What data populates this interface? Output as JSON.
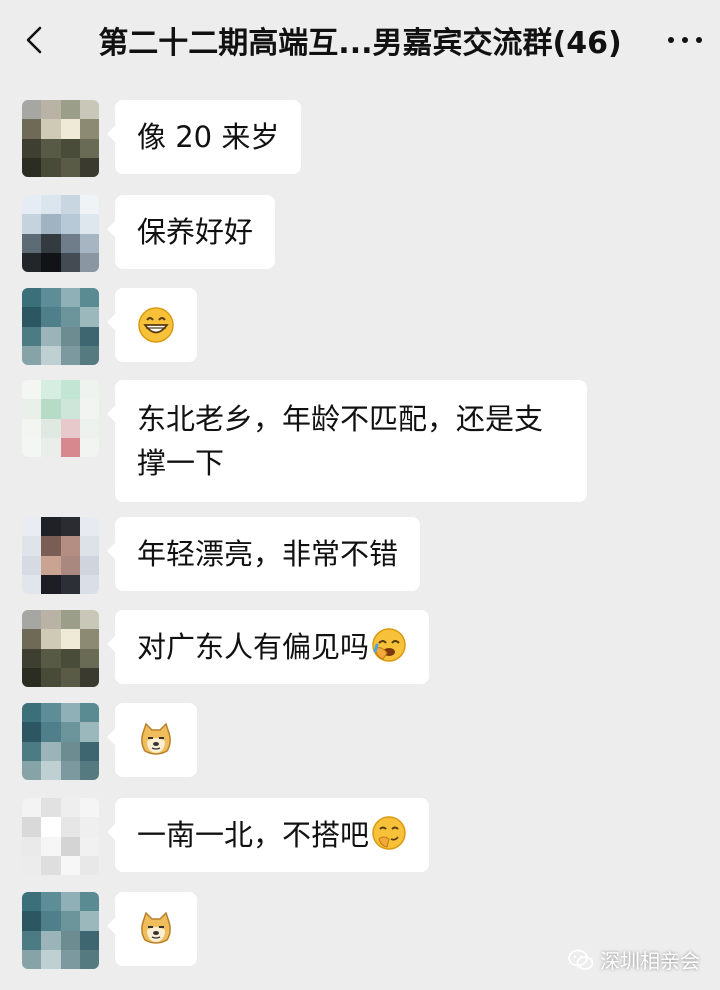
{
  "header": {
    "title": "第二十二期高端互...男嘉宾交流群(46)",
    "back_icon": "chevron-left-icon",
    "more_icon": "more-dots-icon"
  },
  "messages": [
    {
      "text": "像 20 来岁",
      "emoji": null,
      "avatar_colors": [
        "#a6a7a3",
        "#b8b3a5",
        "#9b9f8a",
        "#c9c7b8",
        "#6f6a55",
        "#cfcab5",
        "#efe9d8",
        "#8c8a72",
        "#3e3f30",
        "#575a45",
        "#4a4c3a",
        "#6a6b54",
        "#2b2c22",
        "#494b39",
        "#5a5b46",
        "#3a3b2e"
      ]
    },
    {
      "text": "保养好好",
      "emoji": null,
      "avatar_colors": [
        "#e5ecf3",
        "#dbe5ee",
        "#c8d6e2",
        "#f0f3f6",
        "#c5d3df",
        "#9fb3c3",
        "#b7c8d6",
        "#dfe7ee",
        "#5d6b75",
        "#333a40",
        "#6e7d89",
        "#a6b5c1",
        "#222628",
        "#111316",
        "#444b52",
        "#8a97a2"
      ]
    },
    {
      "text": "",
      "emoji": "grin-emoji",
      "avatar_colors": [
        "#3b6f7a",
        "#5d8e98",
        "#8fb0b6",
        "#5a8a92",
        "#2c5661",
        "#4f7f88",
        "#6c949b",
        "#9bb8bd",
        "#4d7b84",
        "#9bb4b9",
        "#6c8c92",
        "#3e6670",
        "#86a3a8",
        "#bfd0d3",
        "#7b999e",
        "#557a80"
      ]
    },
    {
      "text": "东北老乡，年龄不匹配，还是支撑一下",
      "emoji": null,
      "avatar_colors": [
        "#f3f6f3",
        "#d6ede1",
        "#c3e6d4",
        "#eef3ef",
        "#e9f0ea",
        "#b6dcc8",
        "#cde6d9",
        "#f1f4f1",
        "#f3f5f3",
        "#dfe9e2",
        "#e7c9cb",
        "#eef2ee",
        "#f4f6f4",
        "#eaeeea",
        "#d7888f",
        "#f2f4f2"
      ]
    },
    {
      "text": "年轻漂亮，非常不错",
      "emoji": null,
      "avatar_colors": [
        "#e9ecf2",
        "#1f2127",
        "#2a2c31",
        "#e7eaf0",
        "#dfe3ea",
        "#7a5e55",
        "#b48e82",
        "#dde1e8",
        "#d5dae3",
        "#caa393",
        "#a9897f",
        "#cfd4dd",
        "#e1e5ec",
        "#1c1e24",
        "#2c2f36",
        "#dadee6"
      ]
    },
    {
      "text": "对广东人有偏见吗",
      "emoji": "facepalm-emoji",
      "avatar_colors": [
        "#a6a7a3",
        "#b8b3a5",
        "#9b9f8a",
        "#c9c7b8",
        "#6f6a55",
        "#cfcab5",
        "#efe9d8",
        "#8c8a72",
        "#3e3f30",
        "#575a45",
        "#4a4c3a",
        "#6a6b54",
        "#2b2c22",
        "#494b39",
        "#5a5b46",
        "#3a3b2e"
      ]
    },
    {
      "text": "",
      "emoji": "doge-emoji",
      "avatar_colors": [
        "#3b6f7a",
        "#5d8e98",
        "#8fb0b6",
        "#5a8a92",
        "#2c5661",
        "#4f7f88",
        "#6c949b",
        "#9bb8bd",
        "#4d7b84",
        "#9bb4b9",
        "#6c8c92",
        "#3e6670",
        "#86a3a8",
        "#bfd0d3",
        "#7b999e",
        "#557a80"
      ]
    },
    {
      "text": "一南一北，不搭吧",
      "emoji": "hehe-emoji",
      "avatar_colors": [
        "#f3f3f3",
        "#e1e1e1",
        "#eeeeee",
        "#f5f5f5",
        "#d9d9d9",
        "#ffffff",
        "#e6e6e6",
        "#efefef",
        "#eaeaea",
        "#f6f6f6",
        "#d4d4d4",
        "#f1f1f1",
        "#ececec",
        "#dedede",
        "#f7f7f7",
        "#e8e8e8"
      ]
    },
    {
      "text": "",
      "emoji": "doge-emoji",
      "avatar_colors": [
        "#3b6f7a",
        "#5d8e98",
        "#8fb0b6",
        "#5a8a92",
        "#2c5661",
        "#4f7f88",
        "#6c949b",
        "#9bb8bd",
        "#4d7b84",
        "#9bb4b9",
        "#6c8c92",
        "#3e6670",
        "#86a3a8",
        "#bfd0d3",
        "#7b999e",
        "#557a80"
      ]
    }
  ],
  "watermark": {
    "text": "深圳相亲会",
    "icon": "wechat-icon"
  }
}
